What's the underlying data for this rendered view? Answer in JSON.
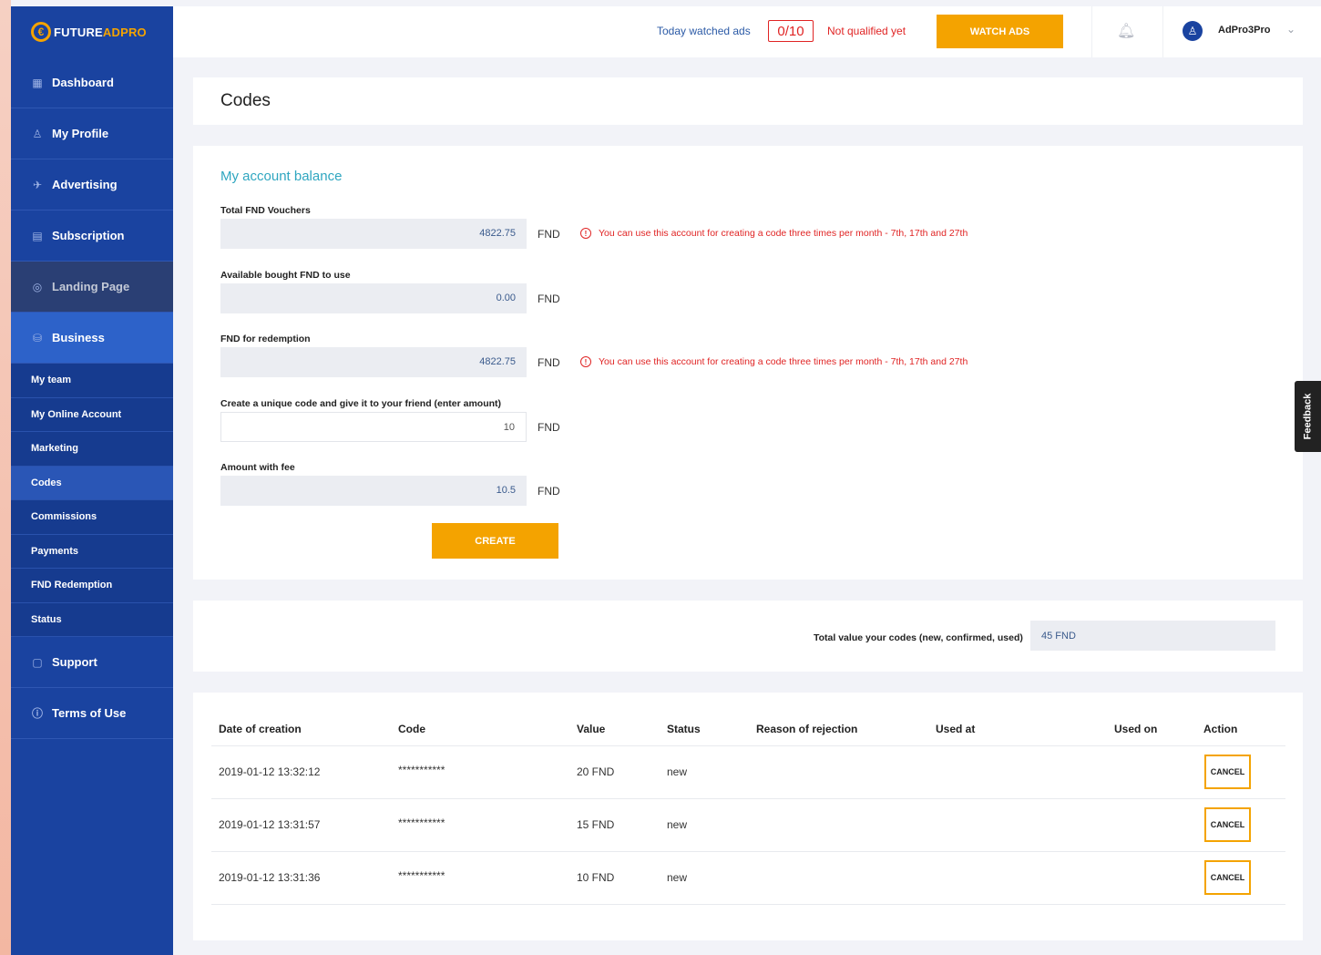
{
  "brand": {
    "logo_mark": "€",
    "logo_main": "FUTURE",
    "logo_accent": "ADPRO"
  },
  "topbar": {
    "watched_label": "Today watched ads",
    "watched_count": "0/10",
    "qualification": "Not qualified yet",
    "watch_button": "WATCH ADS",
    "username": "AdPro3Pro"
  },
  "sidebar": {
    "items": [
      {
        "label": "Dashboard",
        "icon": "grid-icon"
      },
      {
        "label": "My Profile",
        "icon": "user-icon"
      },
      {
        "label": "Advertising",
        "icon": "rocket-icon"
      },
      {
        "label": "Subscription",
        "icon": "list-icon"
      },
      {
        "label": "Landing Page",
        "icon": "globe-icon"
      },
      {
        "label": "Business",
        "icon": "database-icon"
      }
    ],
    "sub_items": [
      {
        "label": "My team"
      },
      {
        "label": "My Online Account"
      },
      {
        "label": "Marketing"
      },
      {
        "label": "Codes"
      },
      {
        "label": "Commissions"
      },
      {
        "label": "Payments"
      },
      {
        "label": "FND Redemption"
      },
      {
        "label": "Status"
      }
    ],
    "bottom_items": [
      {
        "label": "Support",
        "icon": "window-icon"
      },
      {
        "label": "Terms of Use",
        "icon": "info-icon"
      }
    ]
  },
  "page": {
    "title": "Codes"
  },
  "balance": {
    "section_title": "My account balance",
    "unit": "FND",
    "warning": "You can use this account for creating a code three times per month - 7th, 17th and 27th",
    "fields": [
      {
        "label": "Total FND Vouchers",
        "value": "4822.75"
      },
      {
        "label": "Available bought FND to use",
        "value": "0.00"
      },
      {
        "label": "FND for redemption",
        "value": "4822.75"
      },
      {
        "label": "Create a unique code and give it to your friend (enter amount)",
        "value": "10"
      },
      {
        "label": "Amount with fee",
        "value": "10.5"
      }
    ],
    "create_button": "CREATE"
  },
  "totals": {
    "label": "Total value your codes (new, confirmed, used)",
    "value": "45 FND"
  },
  "table": {
    "headers": [
      "Date of creation",
      "Code",
      "Value",
      "Status",
      "Reason of rejection",
      "Used at",
      "Used on",
      "Action"
    ],
    "rows": [
      {
        "date": "2019-01-12 13:32:12",
        "code": "***********",
        "value": "20 FND",
        "status": "new",
        "reason": "",
        "used_at": "",
        "used_on": "",
        "action": "CANCEL"
      },
      {
        "date": "2019-01-12 13:31:57",
        "code": "***********",
        "value": "15 FND",
        "status": "new",
        "reason": "",
        "used_at": "",
        "used_on": "",
        "action": "CANCEL"
      },
      {
        "date": "2019-01-12 13:31:36",
        "code": "***********",
        "value": "10 FND",
        "status": "new",
        "reason": "",
        "used_at": "",
        "used_on": "",
        "action": "CANCEL"
      }
    ]
  },
  "feedback_tab": "Feedback"
}
